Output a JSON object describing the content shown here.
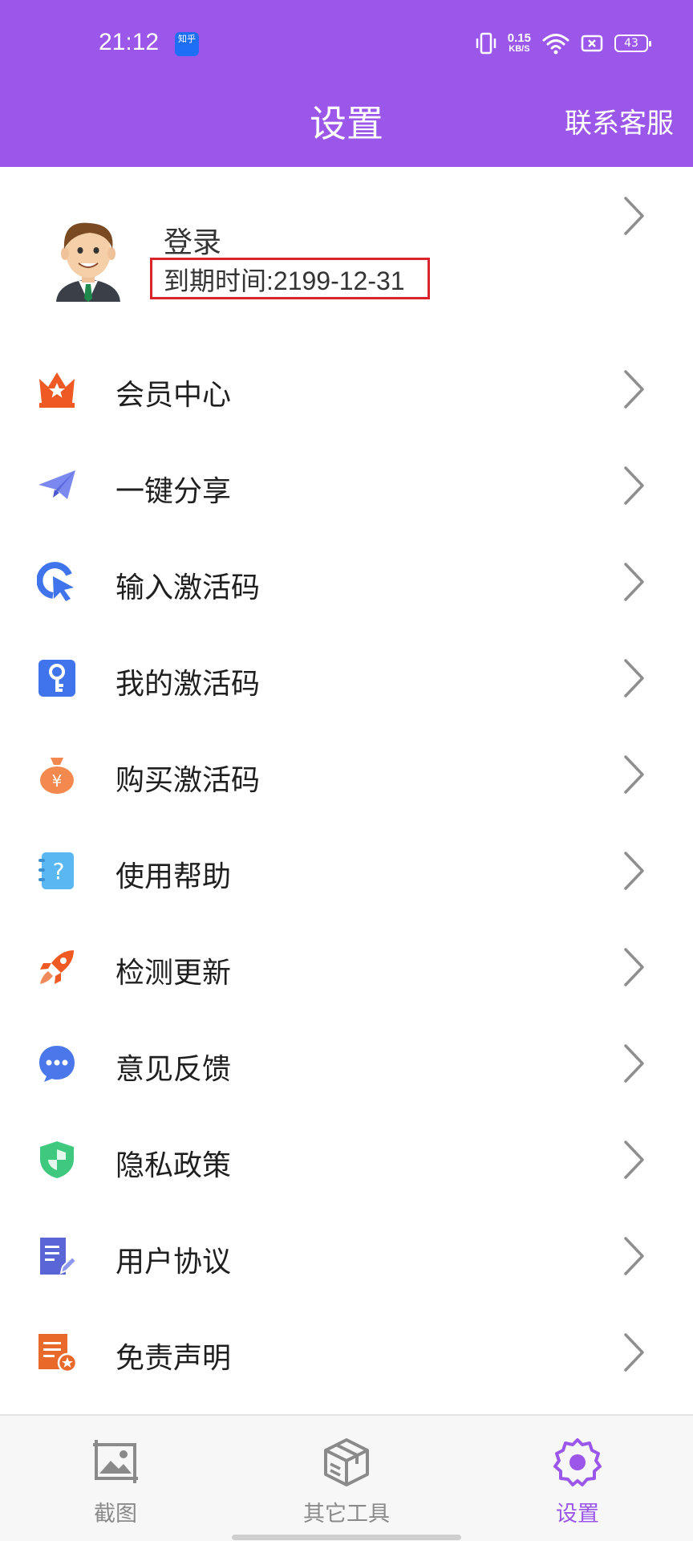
{
  "status_bar": {
    "time": "21:12",
    "app_icon_label": "知乎",
    "net_speed_value": "0.15",
    "net_speed_unit": "KB/S",
    "battery": "43"
  },
  "header": {
    "title": "设置",
    "contact_label": "联系客服"
  },
  "profile": {
    "login_label": "登录",
    "expiry_text": "到期时间:2199-12-31"
  },
  "menu": {
    "items": [
      {
        "label": "会员中心",
        "icon": "crown-star-icon"
      },
      {
        "label": "一键分享",
        "icon": "paper-plane-icon"
      },
      {
        "label": "输入激活码",
        "icon": "cursor-click-icon"
      },
      {
        "label": "我的激活码",
        "icon": "key-icon"
      },
      {
        "label": "购买激活码",
        "icon": "money-bag-icon"
      },
      {
        "label": "使用帮助",
        "icon": "help-notebook-icon"
      },
      {
        "label": "检测更新",
        "icon": "rocket-icon"
      },
      {
        "label": "意见反馈",
        "icon": "chat-bubble-icon"
      },
      {
        "label": "隐私政策",
        "icon": "shield-icon"
      },
      {
        "label": "用户协议",
        "icon": "document-edit-icon"
      },
      {
        "label": "免责声明",
        "icon": "document-star-icon"
      }
    ]
  },
  "bottom_nav": {
    "items": [
      {
        "label": "截图",
        "icon": "screenshot-image-icon",
        "active": false
      },
      {
        "label": "其它工具",
        "icon": "toolbox-icon",
        "active": false
      },
      {
        "label": "设置",
        "icon": "settings-gear-icon",
        "active": true
      }
    ]
  },
  "colors": {
    "accent": "#9b57ea",
    "highlight_box": "#d9242b"
  }
}
